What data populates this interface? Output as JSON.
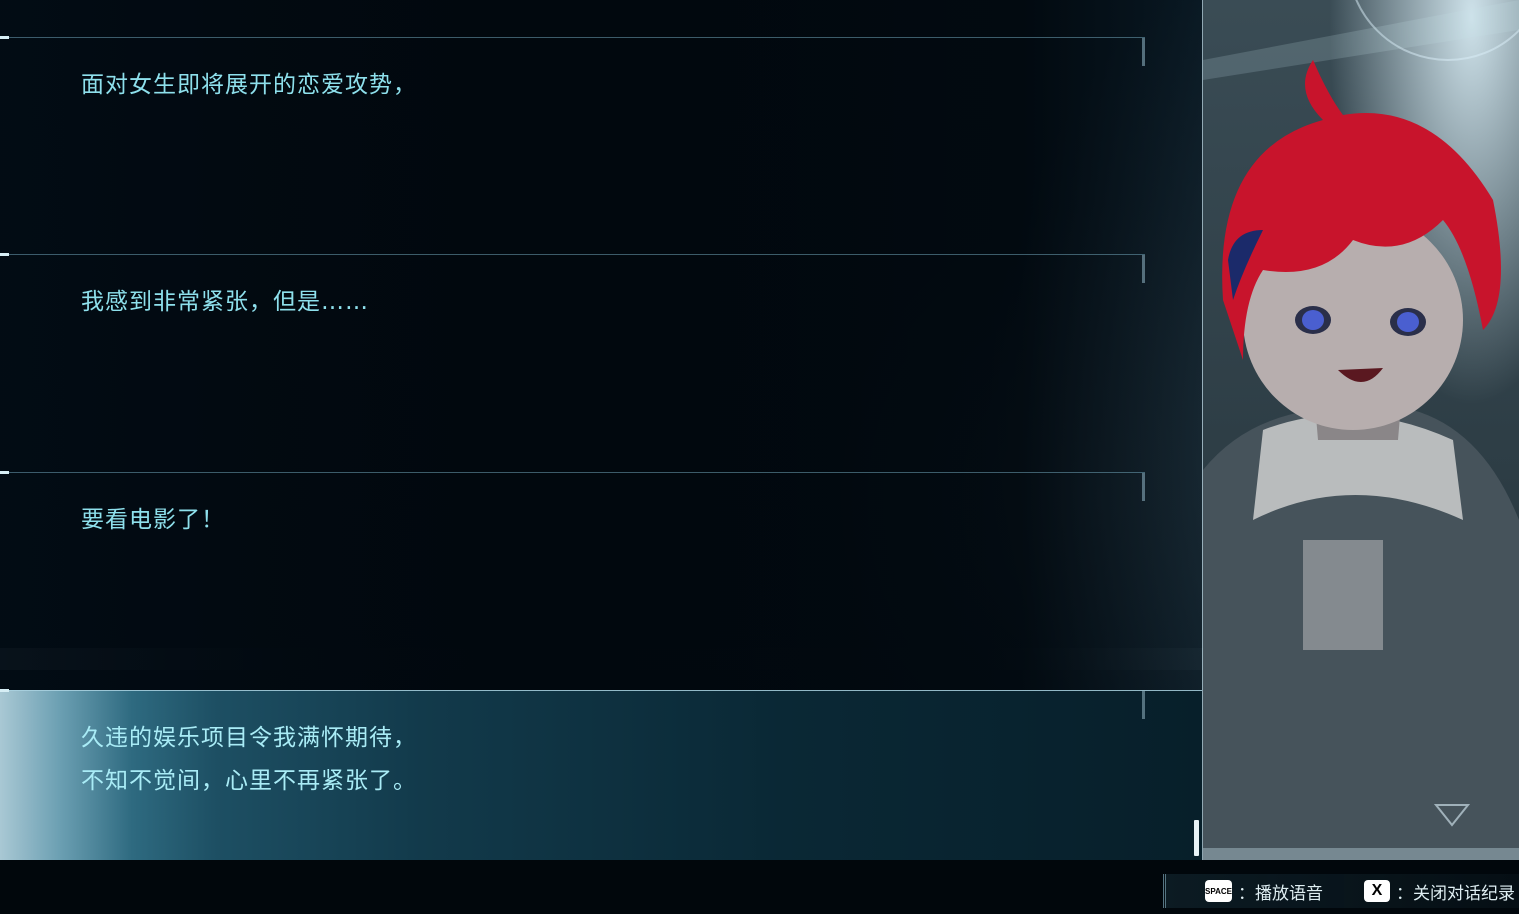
{
  "log": {
    "entries": [
      {
        "text": "面对女生即将展开的恋爱攻势，",
        "active": false
      },
      {
        "text": "我感到非常紧张，但是……",
        "active": false
      },
      {
        "text": "要看电影了！",
        "active": false
      },
      {
        "text": "久违的娱乐项目令我满怀期待，\n不知不觉间，心里不再紧张了。",
        "active": true
      }
    ]
  },
  "portrait": {
    "character": "red-haired-girl-in-hoodie",
    "hair_color": "#c8142c",
    "eye_color": "#4a5fd0"
  },
  "footer": {
    "hints": [
      {
        "key": "SPACE",
        "label": "：播放语音"
      },
      {
        "key": "X",
        "label": "：关闭对话纪录"
      }
    ]
  },
  "colors": {
    "text": "#8ee0ec",
    "highlight": "#1d4f63",
    "background": "#02080d"
  }
}
